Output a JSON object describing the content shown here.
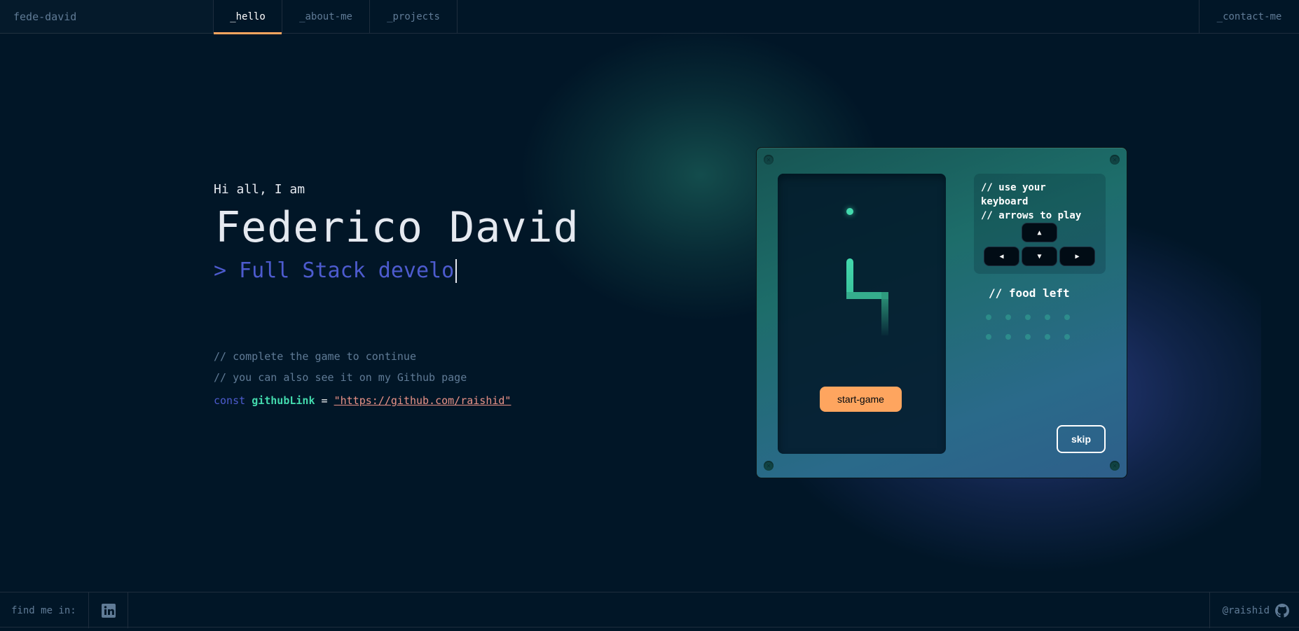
{
  "header": {
    "brand": "fede-david",
    "tabs": [
      {
        "label": "_hello",
        "active": true
      },
      {
        "label": "_about-me",
        "active": false
      },
      {
        "label": "_projects",
        "active": false
      }
    ],
    "contact": "_contact-me"
  },
  "hero": {
    "greeting": "Hi all, I am",
    "name": "Federico David",
    "role": "> Full Stack develo"
  },
  "comments": {
    "line1": "// complete the game to continue",
    "line2": "// you can also see it on my Github page",
    "code": {
      "keyword": "const",
      "variable": "githubLink",
      "operator": "=",
      "value": "\"https://github.com/raishid\""
    }
  },
  "game": {
    "start_label": "start-game",
    "instructions": [
      "// use your keyboard",
      "// arrows to play"
    ],
    "keys": {
      "up": "▲",
      "left": "◀",
      "down": "▼",
      "right": "▶"
    },
    "food_left_label": "// food left",
    "food_left_count": 10,
    "skip_label": "skip",
    "colors": {
      "accent": "#43d9ad",
      "button": "#fea55f"
    }
  },
  "footer": {
    "find_me": "find me in:",
    "social_icon": "linkedin-icon",
    "username": "@raishid",
    "github_icon": "github-icon"
  }
}
